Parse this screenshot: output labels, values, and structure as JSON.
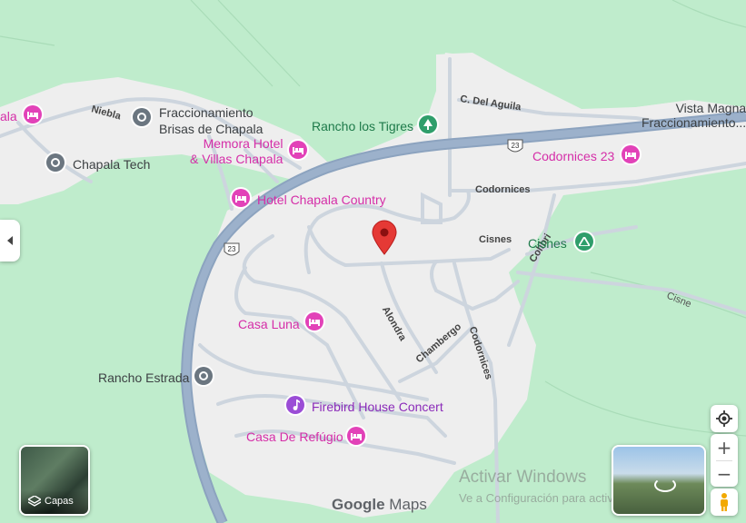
{
  "map": {
    "colors": {
      "land": "#bfeccc",
      "town": "#eeeeee",
      "highway": "#8ea5c2",
      "road": "#cfd6de",
      "poi_pink": "#d52ea8",
      "marker": "#e53935"
    },
    "highway_shields": [
      "23",
      "23"
    ],
    "pois": [
      {
        "id": "hotel-left",
        "label": "ala",
        "type": "hotel"
      },
      {
        "id": "fracc-brisas",
        "label": "Fraccionamiento Brisas de Chapala",
        "line1": "Fraccionamiento",
        "line2": "Brisas de Chapala",
        "type": "place"
      },
      {
        "id": "memora",
        "line1": "Memora Hotel",
        "line2": "& Villas Chapala",
        "type": "hotel"
      },
      {
        "id": "chapala-tech",
        "label": "Chapala Tech",
        "type": "place"
      },
      {
        "id": "rancho-tigres",
        "label": "Rancho los Tigres",
        "type": "park"
      },
      {
        "id": "vista-magna",
        "line1": "Vista Magna",
        "line2": "Fraccionamiento...",
        "type": "place"
      },
      {
        "id": "codornices-23",
        "label": "Codornices 23",
        "type": "hotel"
      },
      {
        "id": "hotel-country",
        "label": "Hotel Chapala Country",
        "type": "hotel"
      },
      {
        "id": "cisnes-park",
        "label": "Cisnes",
        "type": "park"
      },
      {
        "id": "casa-luna",
        "label": "Casa Luna",
        "type": "hotel"
      },
      {
        "id": "rancho-estrada",
        "label": "Rancho Estrada",
        "type": "place"
      },
      {
        "id": "firebird",
        "label": "Firebird House Concert",
        "type": "music"
      },
      {
        "id": "casa-refugio",
        "label": "Casa De Refúgio",
        "type": "hotel"
      }
    ],
    "streets": {
      "niebla": "Niebla",
      "del_aguila": "C. Del Aguila",
      "codornices_top": "Codornices",
      "cisnes_street": "Cisnes",
      "colibri": "Colibri",
      "alondra": "Alondra",
      "chambergo": "Chambergo",
      "codornices_side": "Codornices",
      "cisne": "Cisne"
    }
  },
  "controls": {
    "layers_label": "Capas",
    "zoom_in": "+",
    "zoom_out": "−"
  },
  "branding": {
    "google": "Google",
    "maps": "Maps"
  },
  "watermark": {
    "line1": "Activar Windows",
    "line2": "Ve a Configuración para activar Windows."
  }
}
